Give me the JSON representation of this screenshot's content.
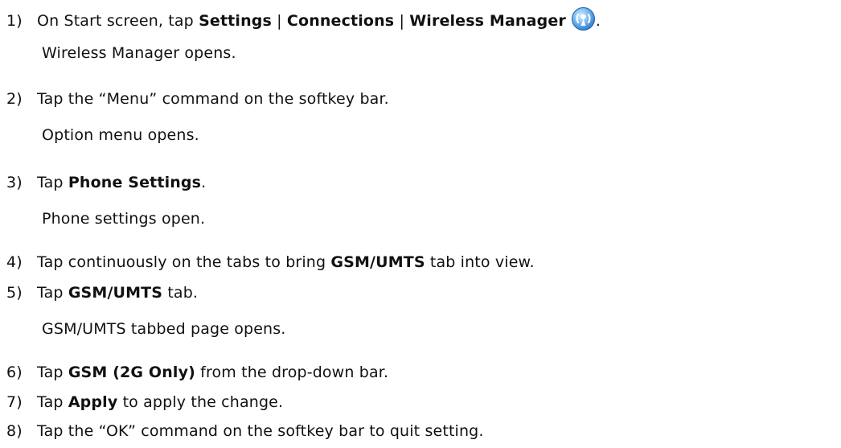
{
  "steps": [
    {
      "number": "1)",
      "parts": [
        {
          "text": "On Start screen, tap ",
          "bold": false
        },
        {
          "text": "Settings",
          "bold": true
        },
        {
          "text": " | ",
          "bold": false
        },
        {
          "text": "Connections",
          "bold": true
        },
        {
          "text": " | ",
          "bold": false
        },
        {
          "text": "Wireless Manager",
          "bold": true
        }
      ],
      "icon": "wireless-manager-icon",
      "after_icon": ".",
      "result": "Wireless Manager opens."
    },
    {
      "number": "2)",
      "parts": [
        {
          "text": "Tap the “Menu” command on the softkey bar.",
          "bold": false
        }
      ],
      "result": "Option menu opens."
    },
    {
      "number": "3)",
      "parts": [
        {
          "text": "Tap ",
          "bold": false
        },
        {
          "text": "Phone Settings",
          "bold": true
        },
        {
          "text": ".",
          "bold": false
        }
      ],
      "result": "Phone settings open."
    },
    {
      "number": "4)",
      "parts": [
        {
          "text": "Tap continuously on the tabs to bring ",
          "bold": false
        },
        {
          "text": "GSM/UMTS",
          "bold": true
        },
        {
          "text": " tab into view.",
          "bold": false
        }
      ]
    },
    {
      "number": "5)",
      "parts": [
        {
          "text": "Tap ",
          "bold": false
        },
        {
          "text": "GSM/UMTS",
          "bold": true
        },
        {
          "text": " tab.",
          "bold": false
        }
      ],
      "result": "GSM/UMTS tabbed page opens."
    },
    {
      "number": "6)",
      "parts": [
        {
          "text": "Tap ",
          "bold": false
        },
        {
          "text": "GSM (2G Only)",
          "bold": true
        },
        {
          "text": " from the drop-down bar.",
          "bold": false
        }
      ]
    },
    {
      "number": "7)",
      "parts": [
        {
          "text": "Tap ",
          "bold": false
        },
        {
          "text": "Apply",
          "bold": true
        },
        {
          "text": " to apply the change.",
          "bold": false
        }
      ]
    },
    {
      "number": "8)",
      "parts": [
        {
          "text": "Tap the “OK” command on the softkey bar to quit setting.",
          "bold": false
        }
      ]
    }
  ],
  "colors": {
    "text": "#111111",
    "icon_blue": "#3f8fd8",
    "icon_light": "#bfe0ff"
  }
}
